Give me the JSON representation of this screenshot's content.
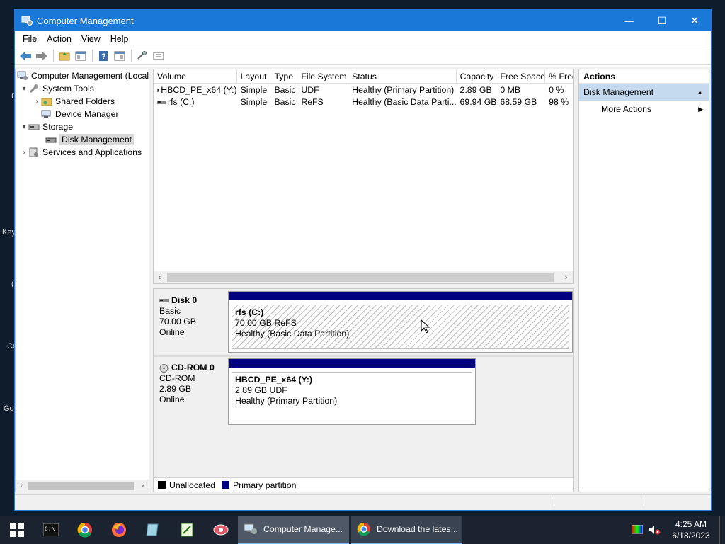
{
  "desktop": {
    "fragments": [
      "F",
      "Key",
      "(",
      "Co",
      "Go"
    ]
  },
  "window": {
    "title": "Computer Management",
    "controls": {
      "minimize": "—",
      "maximize": "☐",
      "close": "✕"
    }
  },
  "menu": [
    "File",
    "Action",
    "View",
    "Help"
  ],
  "tree": {
    "root": "Computer Management (Local",
    "system_tools": "System Tools",
    "shared_folders": "Shared Folders",
    "device_manager": "Device Manager",
    "storage": "Storage",
    "disk_management": "Disk Management",
    "services": "Services and Applications"
  },
  "volumes": {
    "headers": [
      "Volume",
      "Layout",
      "Type",
      "File System",
      "Status",
      "Capacity",
      "Free Space",
      "% Free"
    ],
    "rows": [
      {
        "volume": "HBCD_PE_x64 (Y:)",
        "layout": "Simple",
        "type": "Basic",
        "fs": "UDF",
        "status": "Healthy (Primary Partition)",
        "capacity": "2.89 GB",
        "free": "0 MB",
        "pct": "0 %"
      },
      {
        "volume": "rfs (C:)",
        "layout": "Simple",
        "type": "Basic",
        "fs": "ReFS",
        "status": "Healthy (Basic Data Parti...",
        "capacity": "69.94 GB",
        "free": "68.59 GB",
        "pct": "98 %"
      }
    ]
  },
  "disks": [
    {
      "name": "Disk 0",
      "type": "Basic",
      "size": "70.00 GB",
      "state": "Online",
      "partition": {
        "label": "rfs  (C:)",
        "detail": "70.00 GB ReFS",
        "status": "Healthy (Basic Data Partition)"
      }
    },
    {
      "name": "CD-ROM 0",
      "type": "CD-ROM",
      "size": "2.89 GB",
      "state": "Online",
      "partition": {
        "label": "HBCD_PE_x64  (Y:)",
        "detail": "2.89 GB UDF",
        "status": "Healthy (Primary Partition)"
      }
    }
  ],
  "legend": {
    "unallocated": "Unallocated",
    "primary": "Primary partition"
  },
  "actions": {
    "header": "Actions",
    "section": "Disk Management",
    "item": "More Actions"
  },
  "taskbar": {
    "buttons": [
      "Computer Manage...",
      "Download the lates..."
    ],
    "time": "4:25 AM",
    "date": "6/18/2023"
  },
  "colors": {
    "titlebar": "#1a78d8",
    "primary_partition": "#00007f",
    "action_section": "#c5d9ef"
  }
}
